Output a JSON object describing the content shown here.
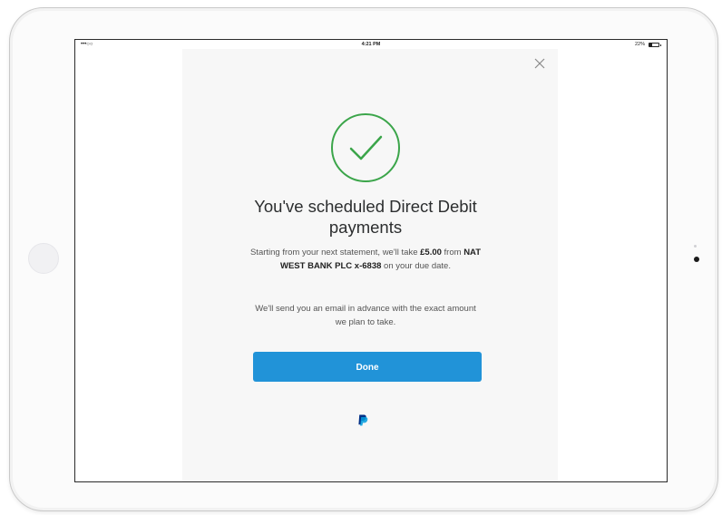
{
  "status_bar": {
    "signal": "•••○○",
    "time": "4:21 PM",
    "battery": "22%"
  },
  "dialog": {
    "close_icon": "close-icon",
    "success_icon": "checkmark-circle-icon",
    "title": "You've scheduled Direct Debit payments",
    "body1_prefix": "Starting from your next statement, we'll take ",
    "amount": "£5.00",
    "body1_mid": " from ",
    "bank": "NAT WEST BANK PLC x-6838",
    "body1_suffix": " on your due date.",
    "body2": "We'll send you an email in advance with the exact amount we plan to take.",
    "done_label": "Done",
    "footer_logo": "paypal-logo"
  },
  "colors": {
    "accent": "#2193d8",
    "success": "#3ba54a",
    "paypal_dark": "#003087",
    "paypal_light": "#009cde"
  }
}
